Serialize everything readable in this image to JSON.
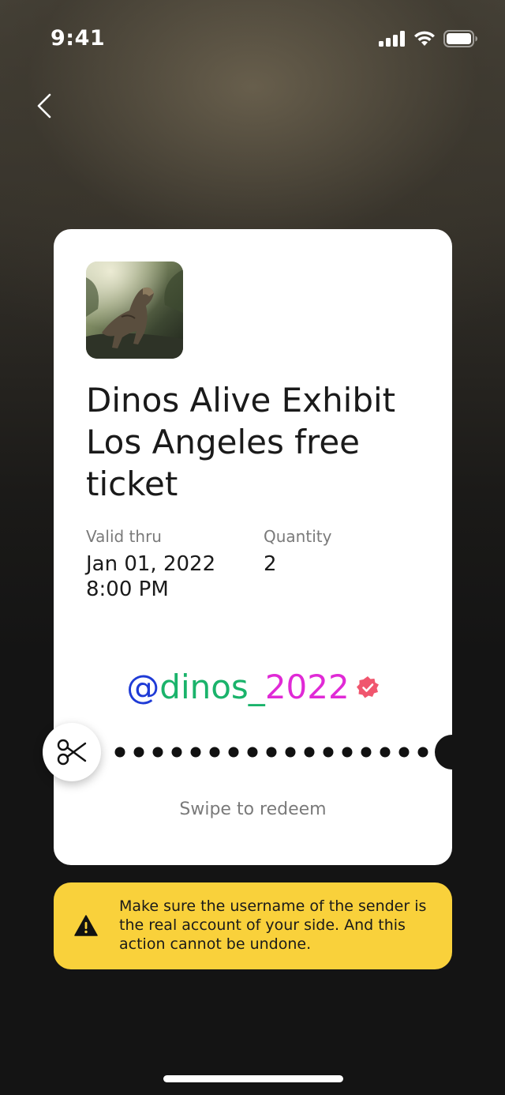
{
  "status_bar": {
    "time": "9:41"
  },
  "ticket": {
    "title": "Dinos Alive Exhibit Los Angeles free ticket",
    "valid_label": "Valid thru",
    "valid_date": "Jan 01, 2022",
    "valid_time": "8:00 PM",
    "quantity_label": "Quantity",
    "quantity_value": "2",
    "username_at": "@",
    "username_name": "dinos_",
    "username_year": "2022",
    "swipe_label": "Swipe to redeem"
  },
  "warning": {
    "text": "Make sure the username of the sender is the real account of your side. And this action cannot be undone."
  },
  "colors": {
    "warning_bg": "#f9d13b",
    "username_at": "#1f3bd6",
    "username_name": "#1ab36b",
    "username_year": "#e02ad6",
    "verified_badge": "#f0566e"
  }
}
